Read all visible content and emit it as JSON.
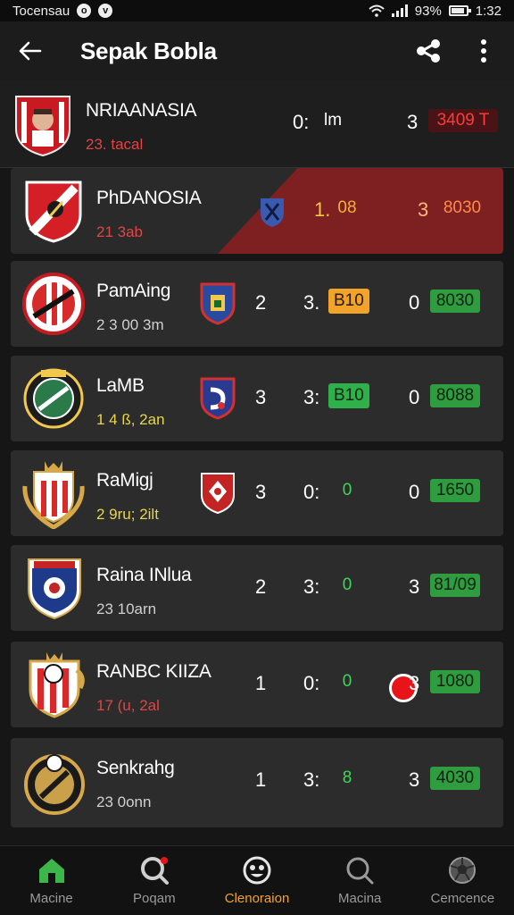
{
  "status_bar": {
    "left_text": "Tocensau",
    "time": "1:32",
    "battery": "93%",
    "dot1": "o",
    "dot2": "v"
  },
  "app_bar": {
    "title": "Sepak Bobla"
  },
  "matches": [
    {
      "name": "NRIAANASIA",
      "time": "23. tacal",
      "score_b": "0:",
      "badge_a": "lm",
      "score_c": "3",
      "badge_b": "3409 T"
    },
    {
      "name": "PhDANOSIA",
      "time": "21 3ab",
      "score_b": "1.",
      "badge_a": "08",
      "score_c": "3",
      "badge_b": "8030"
    },
    {
      "name": "PamAing",
      "time": "2 3 00 3m",
      "score_a": "2",
      "score_b": "3.",
      "badge_a": "B10",
      "score_c": "0",
      "badge_b": "8030"
    },
    {
      "name": "LaMB",
      "time": "1 4 ß, 2an",
      "score_a": "3",
      "score_b": "3:",
      "badge_a": "B10",
      "score_c": "0",
      "badge_b": "8088"
    },
    {
      "name": "RaMigj",
      "time": "2 9ru; 2ilt",
      "score_a": "3",
      "score_b": "0:",
      "badge_a": "0",
      "score_c": "0",
      "badge_b": "1650"
    },
    {
      "name": "Raina INlua",
      "time": "23 10arn",
      "score_a": "2",
      "score_b": "3:",
      "badge_a": "0",
      "score_c": "3",
      "badge_b": "81/09"
    },
    {
      "name": "RANBC KIIZA",
      "time": "17 (u, 2al",
      "score_a": "1",
      "score_b": "0:",
      "badge_a": "0",
      "score_c": "3",
      "badge_b": "1080"
    },
    {
      "name": "Senkrahg",
      "time": "23 0onn",
      "score_a": "1",
      "score_b": "3:",
      "badge_a": "8",
      "score_c": "3",
      "badge_b": "4030"
    }
  ],
  "nav": [
    {
      "label": "Macine",
      "icon": "home-icon"
    },
    {
      "label": "Poqam",
      "icon": "search-notification-icon"
    },
    {
      "label": "Clenoraion",
      "icon": "ball-face-icon"
    },
    {
      "label": "Macina",
      "icon": "magnifier-icon"
    },
    {
      "label": "Cemcence",
      "icon": "soccer-ball-icon"
    }
  ],
  "colors": {
    "accent": "#f2a32a",
    "highlight": "#7e1f21",
    "green_badge": "#2f9c3f",
    "live": "#e8141a"
  }
}
